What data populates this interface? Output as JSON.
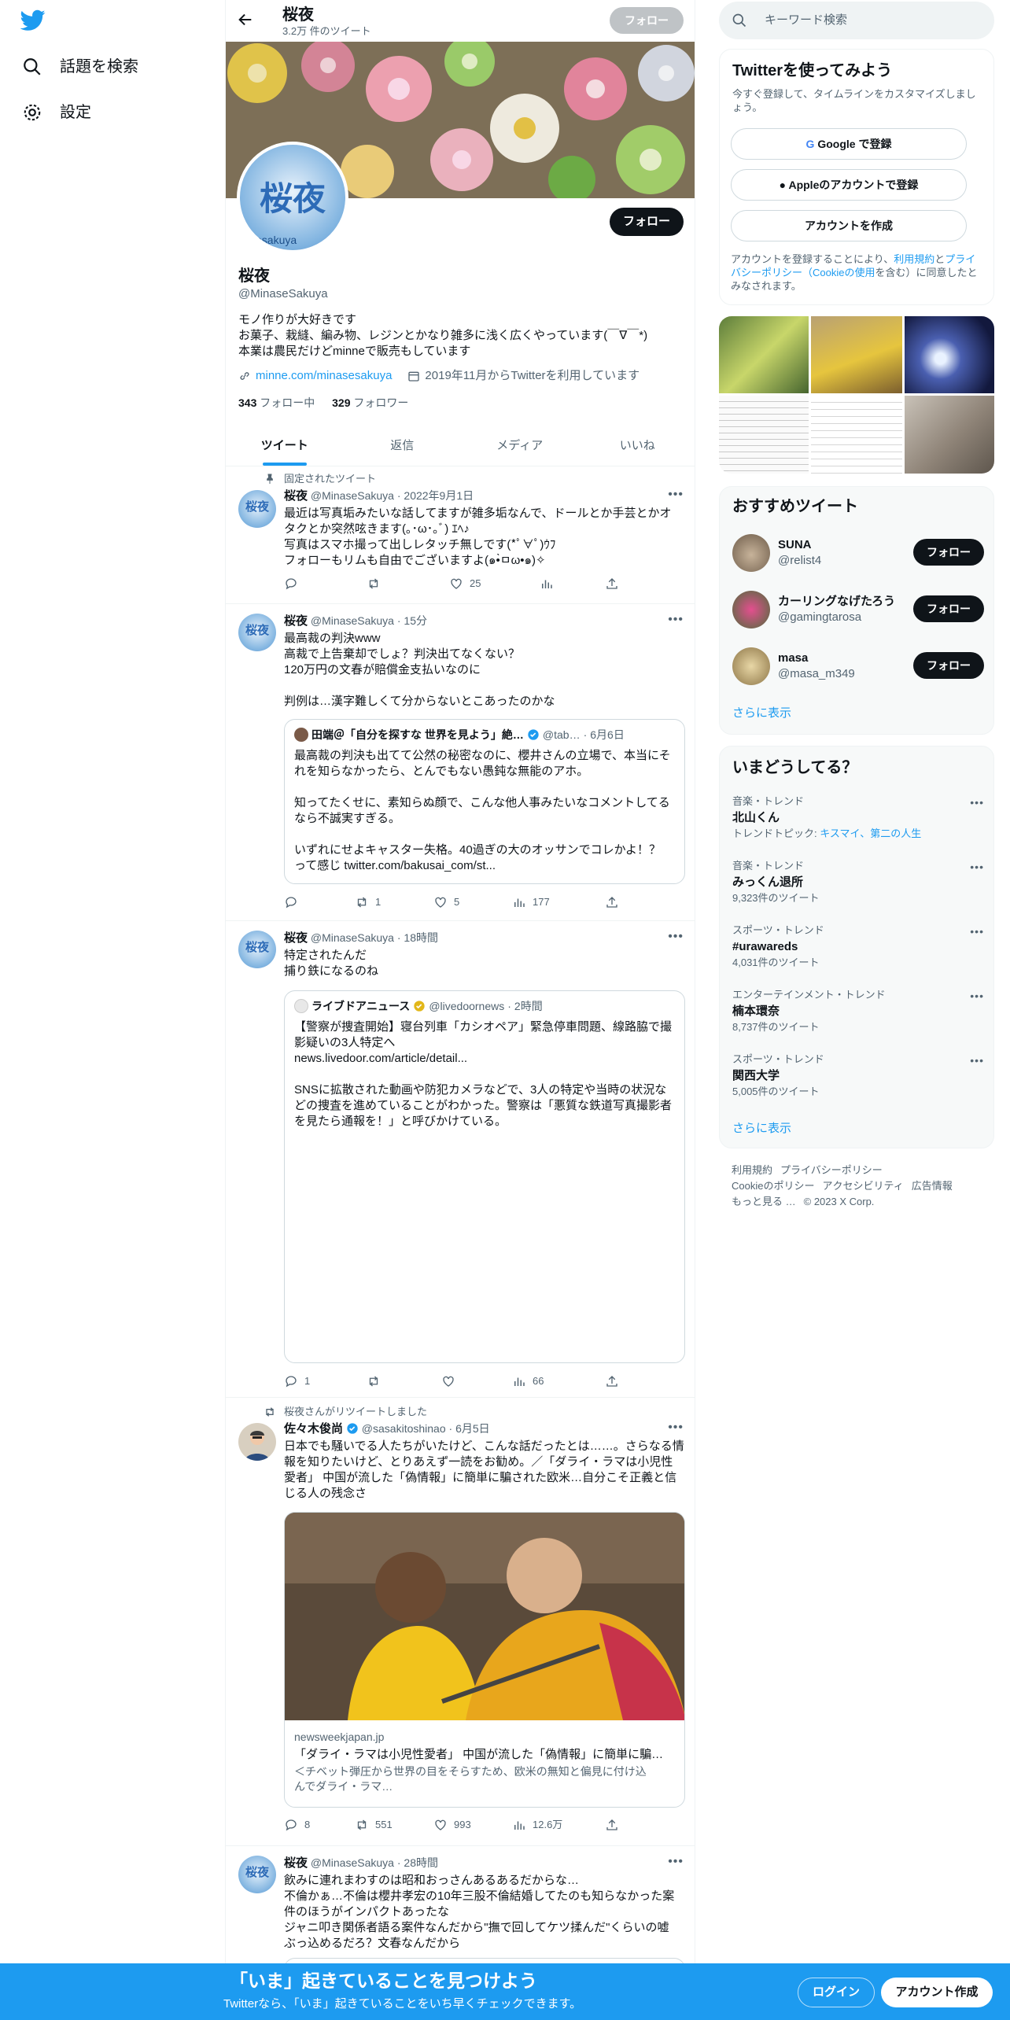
{
  "nav": {
    "explore": "話題を検索",
    "settings": "設定"
  },
  "header": {
    "name": "桜夜",
    "tweet_count": "3.2万 件のツイート",
    "follow": "フォロー"
  },
  "profile": {
    "avatar_text": "桜夜",
    "avatar_sub": "esakuya",
    "follow": "フォロー",
    "name": "桜夜",
    "handle": "@MinaseSakuya",
    "bio_1": "モノ作りが大好きです",
    "bio_2": "お菓子、栽縫、編み物、レジンとかなり雑多に浅く広くやっています(￣∇￣*)",
    "bio_3": "本業は農民だけどminneで販売もしています",
    "link": "minne.com/minasesakuya",
    "joined": "2019年11月からTwitterを利用しています",
    "following_num": "343",
    "following_label": "フォロー中",
    "followers_num": "329",
    "followers_label": "フォロワー"
  },
  "tabs": [
    "ツイート",
    "返信",
    "メディア",
    "いいね"
  ],
  "tweets": {
    "t1": {
      "pinned": "固定されたツイート",
      "name": "桜夜",
      "handle": "@MinaseSakuya",
      "time": "2022年9月1日",
      "text_1": "最近は写真垢みたいな話してますが雑多垢なんで、ドールとか手芸とかオ",
      "text_2": "タクとか突然呟きます(｡･ω･｡ﾞ) ｴﾍ♪",
      "text_3": "写真はスマホ撮って出しレタッチ無しです(*ﾟ∀ﾟ)ｳﾌ",
      "text_4": "フォローもリムも自由でございますよ(๑•̀ㅁω•๑)✧",
      "likes": "25"
    },
    "t2": {
      "name": "桜夜",
      "handle": "@MinaseSakuya",
      "time": "15分",
      "text_1": "最高裁の判決www",
      "text_2": "高裁で上告棄却でしょ？判決出てなくない？",
      "text_3": "120万円の文春が賠償金支払いなのに",
      "text_4": "判例は…漢字難しくて分からないとこあったのかな",
      "q_name": "田端＠「自分を探すな 世界を見よう」絶…",
      "q_handle": "@tab…",
      "q_time": "6月6日",
      "q_text_1": "最高裁の判決も出てて公然の秘密なのに、櫻井さんの立場で、本当にそ",
      "q_text_2": "れを知らなかったら、とんでもない愚鈍な無能のアホ。",
      "q_text_3": "知ってたくせに、素知らぬ顔で、こんな他人事みたいなコメントしてる",
      "q_text_4": "なら不誠実すぎる。",
      "q_text_5": "いずれにせよキャスター失格。40過ぎの大のオッサンでコレかよ！？",
      "q_text_6": "って感じ twitter.com/bakusai_com/st...",
      "retweets": "1",
      "likes": "5",
      "views": "177"
    },
    "t3": {
      "name": "桜夜",
      "handle": "@MinaseSakuya",
      "time": "18時間",
      "text_1": "特定されたんだ",
      "text_2": "捕り鉄になるのね",
      "q_name": "ライブドアニュース",
      "q_handle": "@livedoornews",
      "q_time": "2時間",
      "q_text_1": "【警察が捜査開始】寝台列車「カシオペア」緊急停車問題、線路脇で撮",
      "q_text_2": "影疑いの3人特定へ",
      "q_text_3": "news.livedoor.com/article/detail...",
      "q_text_4": "SNSに拡散された動画や防犯カメラなどで、3人の特定や当時の状況な",
      "q_text_5": "どの捜査を進めていることがわかった。警察は「悪質な鉄道写真撮影者",
      "q_text_6": "を見たら通報を！」と呼びかけている。",
      "replies": "1",
      "views": "66"
    },
    "t4": {
      "retweeted_by": "桜夜さんがリツイートしました",
      "name": "佐々木俊尚",
      "handle": "@sasakitoshinao",
      "time": "6月5日",
      "text_1": "日本でも騒いでる人たちがいたけど、こんな話だったとは……。さらなる情",
      "text_2": "報を知りたいけど、とりあえず一読をお勧め。／「ダライ・ラマは小児性",
      "text_3": "愛者」 中国が流した「偽情報」に簡単に騙された欧米…自分こそ正義と信",
      "text_4": "じる人の残念さ",
      "card_domain": "newsweekjapan.jp",
      "card_title": "「ダライ・ラマは小児性愛者」 中国が流した「偽情報」に簡単に騙…",
      "card_desc_1": "＜チベット弾圧から世界の目をそらすため、欧米の無知と偏見に付け込",
      "card_desc_2": "んでダライ・ラマ…",
      "replies": "8",
      "retweets": "551",
      "likes": "993",
      "views": "12.6万"
    },
    "t5": {
      "name": "桜夜",
      "handle": "@MinaseSakuya",
      "time": "28時間",
      "text_1": "飲みに連れまわすのは昭和おっさんあるあるだからな…",
      "text_2": "不倫かぁ…不倫は櫻井孝宏の10年三股不倫結婚してたのも知らなかった案",
      "text_3": "件のほうがインパクトあったな",
      "text_4": "ジャニ叩き関係者語る案件なんだから\"撫で回してケツ揉んだ\"くらいの嘘",
      "text_5": "ぶっ込めるだろ？文春なんだから"
    }
  },
  "right": {
    "search_placeholder": "キーワード検索",
    "signup": {
      "title": "Twitterを使ってみよう",
      "sub": "今すぐ登録して、タイムラインをカスタマイズしましょう。",
      "google": "Google で登録",
      "apple": "Appleのアカウントで登録",
      "create": "アカウントを作成",
      "legal_1": "アカウントを登録することにより、",
      "legal_terms": "利用規約",
      "legal_2": "と",
      "legal_privacy": "プライバシーポリシー（Cookieの使用",
      "legal_3": "を含む）に同意したとみなされます。"
    },
    "rec_title": "おすすめツイート",
    "recs": [
      {
        "name": "SUNA",
        "handle": "@relist4",
        "btn": "フォロー"
      },
      {
        "name": "カーリングなげたろう",
        "handle": "@gamingtarosa",
        "btn": "フォロー"
      },
      {
        "name": "masa",
        "handle": "@masa_m349",
        "btn": "フォロー"
      }
    ],
    "show_more": "さらに表示",
    "trends_title": "いまどうしてる？",
    "trends": [
      {
        "cat": "音楽・トレンド",
        "name": "北山くん",
        "sub_label": "トレンドトピック: ",
        "sub_link": "キスマイ、第二の人生"
      },
      {
        "cat": "音楽・トレンド",
        "name": "みっくん退所",
        "sub": "9,323件のツイート"
      },
      {
        "cat": "スポーツ・トレンド",
        "name": "#urawareds",
        "sub": "4,031件のツイート"
      },
      {
        "cat": "エンターテインメント・トレンド",
        "name": "楠本環奈",
        "sub": "8,737件のツイート"
      },
      {
        "cat": "スポーツ・トレンド",
        "name": "関西大学",
        "sub": "5,005件のツイート"
      }
    ],
    "footer": {
      "terms": "利用規約",
      "privacy": "プライバシーポリシー",
      "cookie": "Cookieのポリシー",
      "access": "アクセシビリティ",
      "ads": "広告情報",
      "more": "もっと見る …",
      "copy": "© 2023 X Corp."
    }
  },
  "bottom": {
    "title": "「いま」起きていることを見つけよう",
    "sub": "Twitterなら、「いま」起きていることをいち早くチェックできます。",
    "login": "ログイン",
    "signup": "アカウント作成"
  },
  "colors": {
    "accent": "#1d9bf0",
    "text": "#0f1419",
    "muted": "#536471"
  }
}
